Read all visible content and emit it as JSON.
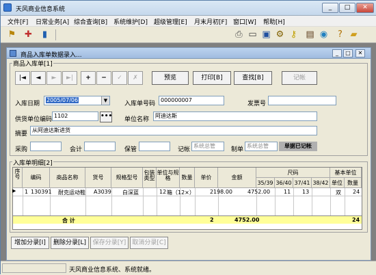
{
  "window": {
    "title": "天风商业信息系统"
  },
  "menu": [
    "文件[F]",
    "日常业务[A]",
    "综合查询[B]",
    "系统维护[D]",
    "超级管理[E]",
    "月末月初[F]",
    "窗口[W]",
    "帮助[H]"
  ],
  "toolbar_icons": [
    "users-icon",
    "pc-icon",
    "chart-icon",
    "print-icon",
    "window-icon",
    "monitor-icon",
    "gear-icon",
    "key-icon",
    "book-icon",
    "globe-icon",
    "help-icon",
    "folder-icon"
  ],
  "child": {
    "title": "商品入库单数据录入..."
  },
  "header_group": {
    "label": "商品入库单[1]"
  },
  "nav": {
    "first": "|◄",
    "prev": "◄",
    "next": "►",
    "last": "►|",
    "add": "+",
    "delete": "−",
    "confirm": "✓",
    "cancel": "✗"
  },
  "actions": {
    "preview": "预览",
    "print": "打印[B]",
    "find": "查找[B]",
    "bookkeep": "记帐"
  },
  "form": {
    "date_label": "入库日期",
    "date_value": "2005/07/06",
    "order_no_label": "入库单号码",
    "order_no_value": "000000007",
    "invoice_label": "发票号",
    "invoice_value": "",
    "supplier_code_label": "供货单位编码",
    "supplier_code_value": "1102",
    "unit_name_label": "单位名称",
    "unit_name_value": "阿迪达斯",
    "summary_label": "摘要",
    "summary_value": "从阿迪达斯进货",
    "purchase_label": "采购",
    "purchase_value": "",
    "accountant_label": "会计",
    "accountant_value": "",
    "keeper_label": "保管",
    "keeper_value": "",
    "bookkeeper_label": "记帐",
    "bookkeeper_value": "系统总管",
    "maker_label": "制单",
    "maker_value": "系统总管",
    "status": "单据已记帐"
  },
  "detail_group": {
    "label": "入库单明细[2]"
  },
  "grid": {
    "headers": {
      "seq": "序号",
      "code": "编码",
      "name": "商品名称",
      "item_no": "货号",
      "spec": "规格型号",
      "pack_type": "包装类型",
      "unit_spec": "单位与规格",
      "qty": "数量",
      "price": "单价",
      "amount": "金额",
      "size_group": "尺码",
      "s1": "35/39",
      "s2": "36/40",
      "s3": "37/41",
      "s4": "38/42",
      "base_unit_group": "基本单位",
      "base_unit": "单位",
      "base_qty": "数量"
    },
    "rows": [
      {
        "seq": "1",
        "code": "130391",
        "name": "耐克运动鞋",
        "item_no": "A3039",
        "spec": "白深蓝",
        "pack_type": "12",
        "unit_spec": "箱（12×）",
        "qty": "2",
        "price": "198.00",
        "amount": "4752.00",
        "s1": "11",
        "s2": "13",
        "s3": "",
        "s4": "",
        "base_unit": "双",
        "base_qty": "24"
      }
    ],
    "total": {
      "label": "合  计",
      "qty": "2",
      "amount": "4752.00",
      "base_qty": "24"
    }
  },
  "bottom": {
    "add_line": "增加分录[I]",
    "delete_line": "删除分录[L]",
    "save_line": "保存分录[Y]",
    "cancel_line": "取消分录[C]"
  },
  "status": {
    "text": "天风商业信息系统、系统就绪。"
  },
  "colors": {
    "highlight": "#3163c5",
    "total_row": "#ffff99",
    "selected_blue": "#316ac5"
  }
}
